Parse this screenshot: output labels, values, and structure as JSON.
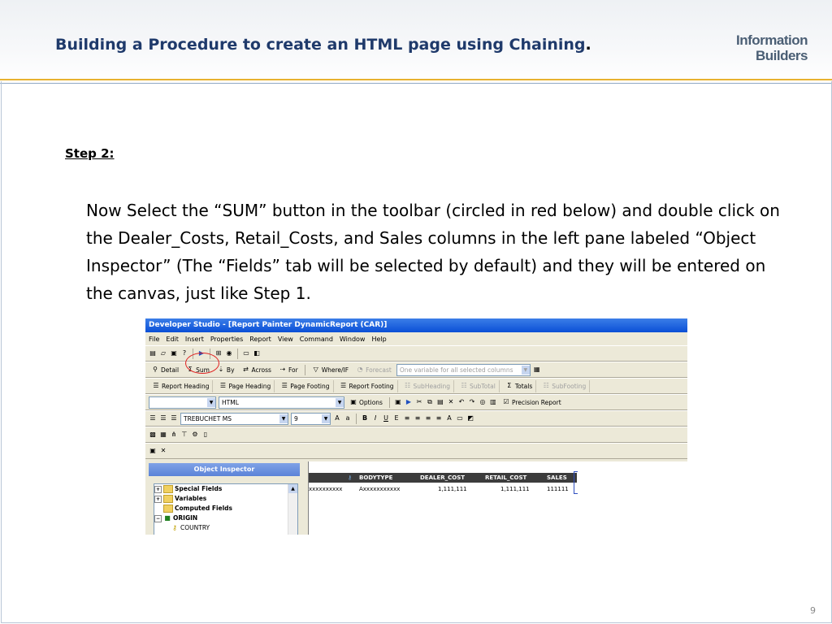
{
  "slide": {
    "title": "Building a Procedure to create an HTML page using Chaining",
    "title_period": ".",
    "logo_line1": "Information",
    "logo_line2": "Builders",
    "step": "Step 2:",
    "body": "Now Select the “SUM” button in the toolbar (circled in red below)  and double click on the Dealer_Costs, Retail_Costs, and Sales columns in the left pane labeled “Object Inspector” (The “Fields” tab  will be selected by default) and they will be entered on the canvas, just like Step 1.",
    "page_number": "9"
  },
  "app": {
    "window_title": "Developer Studio - [Report Painter DynamicReport (CAR)]",
    "menu": [
      "File",
      "Edit",
      "Insert",
      "Properties",
      "Report",
      "View",
      "Command",
      "Window",
      "Help"
    ],
    "toolbar2": {
      "detail": "Detail",
      "sum": "Sum",
      "by": "By",
      "across": "Across",
      "for": "For",
      "whereif": "Where/IF",
      "forecast": "Forecast",
      "variable_combo": "One variable for all selected columns"
    },
    "toolbar3": {
      "report_heading": "Report Heading",
      "page_heading": "Page Heading",
      "page_footing": "Page Footing",
      "report_footing": "Report Footing",
      "subheading": "SubHeading",
      "subtotal": "SubTotal",
      "totals": "Totals",
      "subfooting": "SubFooting"
    },
    "toolbar4": {
      "format_combo": "HTML",
      "options": "Options",
      "precision_report": "Precision Report"
    },
    "toolbar5": {
      "font_combo": "TREBUCHET MS",
      "size_combo": "9",
      "bold": "B",
      "italic": "I",
      "underline": "U"
    },
    "object_inspector": {
      "title": "Object Inspector",
      "items": [
        "Special Fields",
        "Variables",
        "Computed Fields",
        "ORIGIN",
        "COUNTRY"
      ]
    },
    "canvas": {
      "headers": [
        "BODYTYPE",
        "DEALER_COST",
        "RETAIL_COST",
        "SALES"
      ],
      "row": [
        "xxxxxxxxxx",
        "Axxxxxxxxxxx",
        "1,111,111",
        "1,111,111",
        "111111"
      ]
    }
  }
}
